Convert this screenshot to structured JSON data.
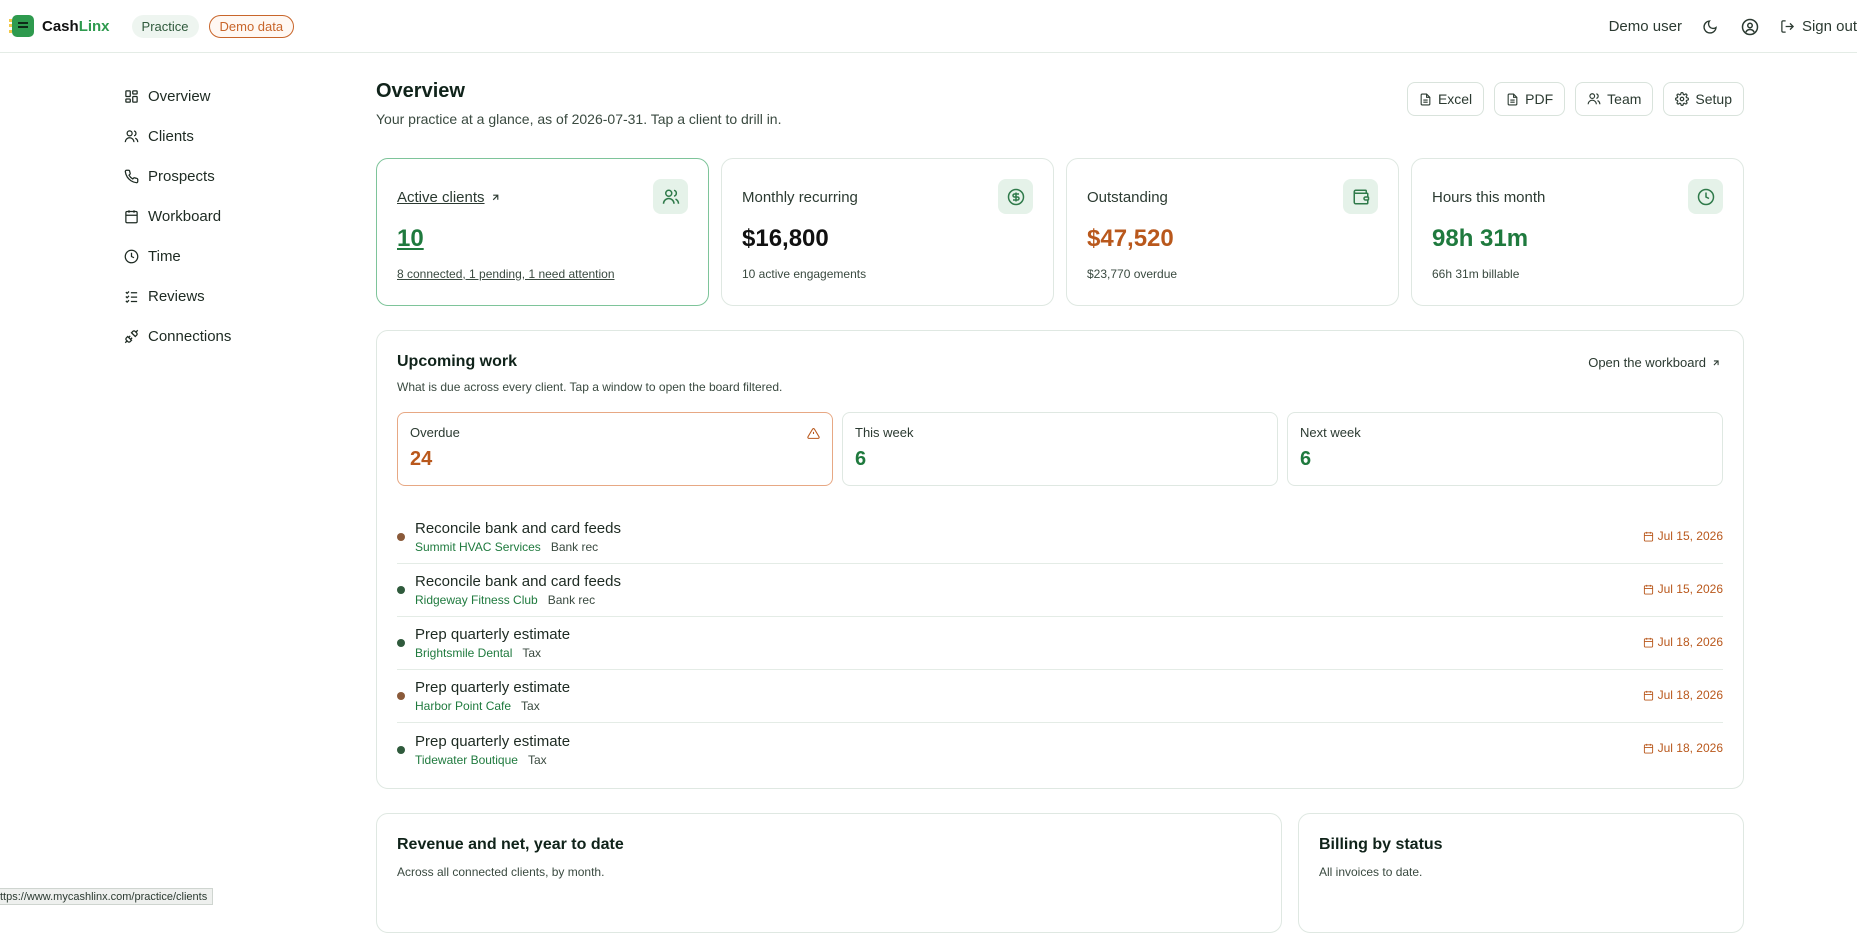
{
  "topbar": {
    "brand_prefix": "Cash",
    "brand_suffix": "Linx",
    "practice_pill": "Practice",
    "demo_pill": "Demo data",
    "user_name": "Demo user",
    "sign_out": "Sign out"
  },
  "sidebar": {
    "items": [
      {
        "label": "Overview",
        "icon": "grid-icon"
      },
      {
        "label": "Clients",
        "icon": "users-icon"
      },
      {
        "label": "Prospects",
        "icon": "phone-icon"
      },
      {
        "label": "Workboard",
        "icon": "calendar-icon"
      },
      {
        "label": "Time",
        "icon": "clock-icon"
      },
      {
        "label": "Reviews",
        "icon": "checklist-icon"
      },
      {
        "label": "Connections",
        "icon": "plug-icon"
      }
    ]
  },
  "header": {
    "title": "Overview",
    "subtitle": "Your practice at a glance, as of 2026-07-31. Tap a client to drill in.",
    "buttons": [
      "Excel",
      "PDF",
      "Team",
      "Setup"
    ]
  },
  "stats": [
    {
      "label": "Active clients",
      "value": "10",
      "note": "8 connected, 1 pending, 1 need attention"
    },
    {
      "label": "Monthly recurring",
      "value": "$16,800",
      "note": "10 active engagements"
    },
    {
      "label": "Outstanding",
      "value": "$47,520",
      "note": "$23,770 overdue"
    },
    {
      "label": "Hours this month",
      "value": "98h 31m",
      "note": "66h 31m billable"
    }
  ],
  "upcoming": {
    "title": "Upcoming work",
    "subtitle": "What is due across every client. Tap a window to open the board filtered.",
    "open_link": "Open the workboard",
    "windows": [
      {
        "label": "Overdue",
        "count": "24"
      },
      {
        "label": "This week",
        "count": "6"
      },
      {
        "label": "Next week",
        "count": "6"
      }
    ],
    "tasks": [
      {
        "title": "Reconcile bank and card feeds",
        "client": "Summit HVAC Services",
        "category": "Bank rec",
        "date": "Jul 15, 2026",
        "dot": "#8a5a3a"
      },
      {
        "title": "Reconcile bank and card feeds",
        "client": "Ridgeway Fitness Club",
        "category": "Bank rec",
        "date": "Jul 15, 2026",
        "dot": "#2f5a3c"
      },
      {
        "title": "Prep quarterly estimate",
        "client": "Brightsmile Dental",
        "category": "Tax",
        "date": "Jul 18, 2026",
        "dot": "#2f5a3c"
      },
      {
        "title": "Prep quarterly estimate",
        "client": "Harbor Point Cafe",
        "category": "Tax",
        "date": "Jul 18, 2026",
        "dot": "#8a5a3a"
      },
      {
        "title": "Prep quarterly estimate",
        "client": "Tidewater Boutique",
        "category": "Tax",
        "date": "Jul 18, 2026",
        "dot": "#2f5a3c"
      }
    ]
  },
  "revenue_card": {
    "title": "Revenue and net, year to date",
    "subtitle": "Across all connected clients, by month."
  },
  "billing_card": {
    "title": "Billing by status",
    "subtitle": "All invoices to date."
  },
  "status_url": "ttps://www.mycashlinx.com/practice/clients",
  "colors": {
    "accent": "#1f7a3e",
    "warning": "#b9581c"
  }
}
